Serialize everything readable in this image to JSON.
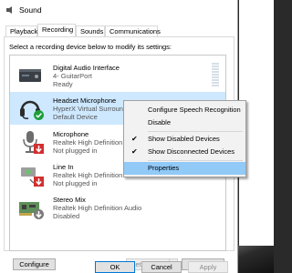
{
  "window": {
    "title": "Sound"
  },
  "tabs": [
    {
      "label": "Playback"
    },
    {
      "label": "Recording"
    },
    {
      "label": "Sounds"
    },
    {
      "label": "Communications"
    }
  ],
  "instructions": "Select a recording device below to modify its settings:",
  "devices": [
    {
      "name": "Digital Audio Interface",
      "line2": "4- GuitarPort",
      "line3": "Ready",
      "icon": "audio-interface-icon"
    },
    {
      "name": "Headset Microphone",
      "line2": "HyperX Virtual Surround",
      "line3": "Default Device",
      "icon": "headset-icon",
      "badge": "default-check-icon"
    },
    {
      "name": "Microphone",
      "line2": "Realtek High Definition",
      "line3": "Not plugged in",
      "icon": "microphone-icon",
      "badge": "unplugged-arrow-icon"
    },
    {
      "name": "Line In",
      "line2": "Realtek High Definition",
      "line3": "Not plugged in",
      "icon": "line-in-jack-icon",
      "badge": "unplugged-arrow-icon"
    },
    {
      "name": "Stereo Mix",
      "line2": "Realtek High Definition Audio",
      "line3": "Disabled",
      "icon": "sound-card-icon",
      "badge": "disabled-arrow-icon"
    }
  ],
  "context_menu": {
    "items": [
      {
        "label": "Configure Speech Recognition",
        "checked": false
      },
      {
        "label": "Disable",
        "checked": false
      },
      {
        "label": "Show Disabled Devices",
        "checked": true
      },
      {
        "label": "Show Disconnected Devices",
        "checked": true
      },
      {
        "label": "Properties",
        "checked": false,
        "highlighted": true
      }
    ]
  },
  "buttons": {
    "configure": "Configure",
    "set_default": "Set Default",
    "properties": "Properties",
    "ok": "OK",
    "cancel": "Cancel",
    "apply": "Apply"
  },
  "colors": {
    "selection": "#cde8ff",
    "menu_highlight": "#91c9f7",
    "check_green": "#1e9e3a",
    "unplugged_red": "#d32f2f"
  }
}
